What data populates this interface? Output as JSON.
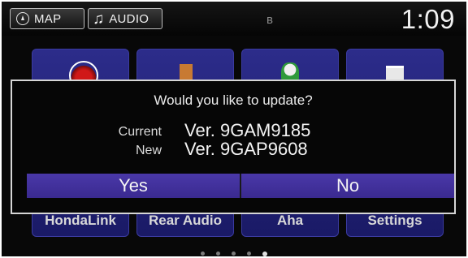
{
  "topbar": {
    "map_label": "MAP",
    "map_icon": "compass-icon",
    "audio_label": "AUDIO",
    "audio_icon": "music-note-icon",
    "bluetooth_icon": "bluetooth-icon",
    "clock": "1:09"
  },
  "home_tiles": [
    {
      "label": "HondaLink",
      "icon": "hondalink-icon"
    },
    {
      "label": "Rear Audio",
      "icon": "rear-audio-icon"
    },
    {
      "label": "Aha",
      "icon": "aha-icon"
    },
    {
      "label": "Settings",
      "icon": "settings-icon"
    }
  ],
  "dialog": {
    "title": "Would you like to update?",
    "current_label": "Current",
    "current_version": "Ver. 9GAM9185",
    "new_label": "New",
    "new_version": "Ver. 9GAP9608",
    "yes_label": "Yes",
    "no_label": "No"
  },
  "page_indicator": {
    "total": 5,
    "active_index": 4
  },
  "colors": {
    "button": "#3a2a90",
    "tile": "#2a2a84",
    "background": "#080808"
  }
}
